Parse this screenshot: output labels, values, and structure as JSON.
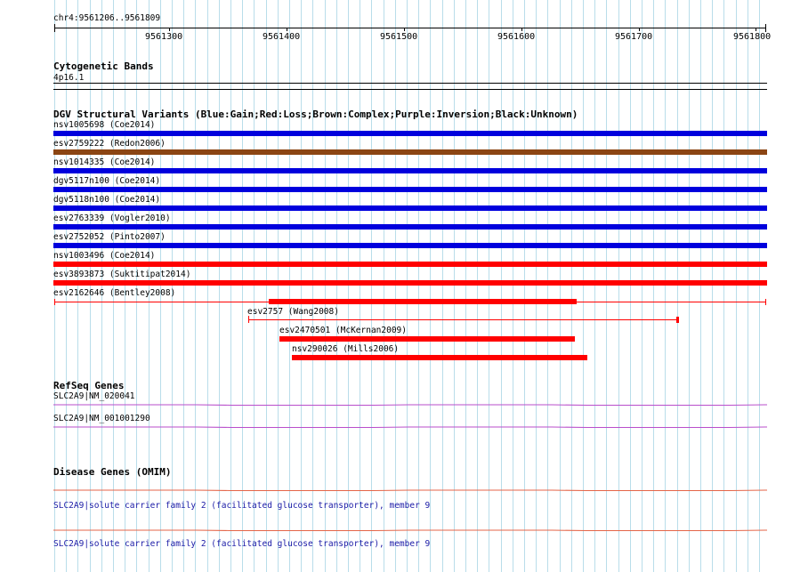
{
  "ruler": {
    "position": "chr4:9561206..9561809",
    "ticks": [
      "9561300",
      "9561400",
      "9561500",
      "9561600",
      "9561700",
      "9561800"
    ]
  },
  "cytobands": {
    "title": "Cytogenetic Bands",
    "band": "4p16.1"
  },
  "dgv": {
    "title": "DGV Structural Variants (Blue:Gain;Red:Loss;Brown:Complex;Purple:Inversion;Black:Unknown)",
    "variants": [
      {
        "label": "nsv1005698 (Coe2014)",
        "color": "#0000dd"
      },
      {
        "label": "esv2759222 (Redon2006)",
        "color": "#8b4513"
      },
      {
        "label": "nsv1014335 (Coe2014)",
        "color": "#0000dd"
      },
      {
        "label": "dgv5117n100 (Coe2014)",
        "color": "#0000dd"
      },
      {
        "label": "dgv5118n100 (Coe2014)",
        "color": "#0000dd"
      },
      {
        "label": "esv2763339 (Vogler2010)",
        "color": "#0000dd"
      },
      {
        "label": "esv2752052 (Pinto2007)",
        "color": "#0000dd"
      },
      {
        "label": "nsv1003496 (Coe2014)",
        "color": "#ff0000"
      },
      {
        "label": "esv3893873 (Suktitipat2014)",
        "color": "#ff0000"
      },
      {
        "label": "esv2162646 (Bentley2008)",
        "color": "#ff0000"
      },
      {
        "label": "esv2757 (Wang2008)",
        "color": "#ff0000"
      },
      {
        "label": "esv2470501 (McKernan2009)",
        "color": "#ff0000"
      },
      {
        "label": "nsv290026 (Mills2006)",
        "color": "#ff0000"
      }
    ]
  },
  "refseq": {
    "title": "RefSeq Genes",
    "genes": [
      "SLC2A9|NM_020041",
      "SLC2A9|NM_001001290"
    ],
    "color": "#b94ecb"
  },
  "omim": {
    "title": "Disease Genes (OMIM)",
    "genes": [
      "SLC2A9|solute carrier family 2 (facilitated glucose transporter), member 9",
      "SLC2A9|solute carrier family 2 (facilitated glucose transporter), member 9"
    ],
    "color": "#e46548"
  }
}
